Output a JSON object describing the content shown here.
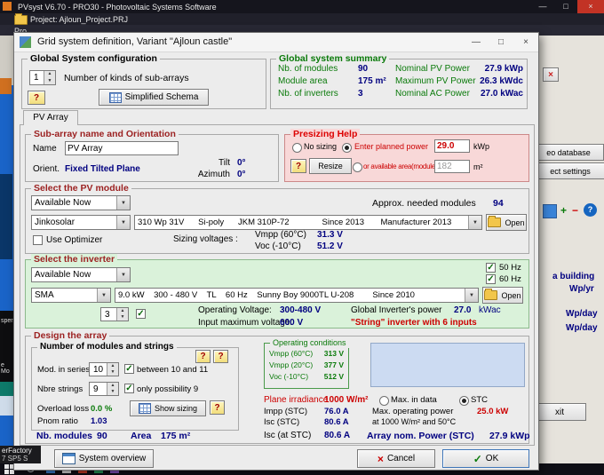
{
  "icons": {
    "minimize": "—",
    "maximize": "□",
    "close": "×",
    "combo_arrow": "▼",
    "spin_up": "▲",
    "spin_down": "▼",
    "check": "✓",
    "ok_check": "✓",
    "cancel_x": "×",
    "help": "?",
    "plus": "+",
    "minus": "−"
  },
  "titlebar": {
    "title": "PVsyst V6.70 - PRO30 - Photovoltaic Systems Software"
  },
  "project_bar": {
    "title": "Project: Ajloun_Project.PRJ",
    "menu_fragment": "Pro"
  },
  "dialog": {
    "title": "Grid system definition, Variant \"Ajloun castle\"",
    "config": {
      "title": "Global System configuration",
      "count": "1",
      "label": "Number of kinds of sub-arrays",
      "schema_btn": "Simplified Schema"
    },
    "summary": {
      "title": "Global system summary",
      "rows": [
        {
          "l1": "Nb. of modules",
          "v1": "90",
          "l2": "Nominal PV Power",
          "v2": "27.9 kWp"
        },
        {
          "l1": "Module area",
          "v1": "175 m²",
          "l2": "Maximum PV Power",
          "v2": "26.3 kWdc"
        },
        {
          "l1": "Nb. of inverters",
          "v1": "3",
          "l2": "Nominal AC Power",
          "v2": "27.0 kWac"
        }
      ]
    },
    "tab": "PV Array",
    "subarray": {
      "title": "Sub-array name and Orientation",
      "name_label": "Name",
      "name": "PV Array",
      "orient_label": "Orient.",
      "orient": "Fixed Tilted Plane",
      "tilt_label": "Tilt",
      "tilt": "0°",
      "azimuth_label": "Azimuth",
      "azimuth": "0°"
    },
    "presizing": {
      "title": "Presizing Help",
      "no_sizing": "No sizing",
      "planned_label": "Enter planned power",
      "planned": "29.0",
      "planned_unit": "kWp",
      "resize": "Resize",
      "area_label": "or available area(modules)",
      "area": "182",
      "area_unit": "m²"
    },
    "module": {
      "title": "Select the PV module",
      "filter": "Available Now",
      "approx_label": "Approx. needed modules",
      "approx": "94",
      "maker": "Jinkosolar",
      "model": "310 Wp 31V      Si-poly      JKM 310P-72              Since 2013       Manufacturer 2013",
      "open": "Open",
      "optimizer": "Use Optimizer",
      "sizing_label": "Sizing voltages :",
      "vmpp_label": "Vmpp (60°C)",
      "vmpp": "31.3 V",
      "voc_label": "Voc (-10°C)",
      "voc": "51.2 V"
    },
    "inverter": {
      "title": "Select the inverter",
      "filter": "Available Now",
      "f50": "50 Hz",
      "f60": "60 Hz",
      "maker": "SMA",
      "model": "9.0 kW    300 - 480 V    TL    60 Hz    Sunny Boy 9000TL U-208        Since 2010",
      "open": "Open",
      "nb_label": "Nb. of inverters",
      "nb": "3",
      "op_v_label": "Operating Voltage:",
      "op_v": "300-480 V",
      "gpow_label": "Global Inverter's power",
      "gpow": "27.0",
      "gpow_unit": "kWac",
      "max_v_label": "Input maximum voltage:",
      "max_v": "600 V",
      "note": "\"String\" inverter with 6 inputs"
    },
    "design": {
      "title": "Design the array",
      "mods": {
        "title": "Number of modules and strings",
        "series_label": "Mod. in series",
        "series": "10",
        "series_hint": "between 10 and 11",
        "strings_label": "Nbre strings",
        "strings": "9",
        "strings_hint": "only possibility 9",
        "overload_label": "Overload loss",
        "overload": "0.0 %",
        "pnom_label": "Pnom ratio",
        "pnom": "1.03",
        "show_sizing": "Show sizing"
      },
      "opcond": {
        "title": "Operating conditions",
        "rows": [
          {
            "l": "Vmpp (60°C)",
            "v": "313 V"
          },
          {
            "l": "Vmpp (20°C)",
            "v": "377 V"
          },
          {
            "l": "Voc (-10°C)",
            "v": "512 V"
          }
        ]
      },
      "irr_label": "Plane irradiance",
      "irr": "1000 W/m²",
      "max_in_data": "Max. in data",
      "stc": "STC",
      "impp_label": "Impp (STC)",
      "impp": "76.0 A",
      "isc_label": "Isc (STC)",
      "isc": "80.6 A",
      "mp_label": "Max. operating power",
      "mp": "25.0 kW",
      "mp_cond": "at 1000 W/m² and 50°C",
      "isc2_label": "Isc (at STC)",
      "isc2": "80.6 A",
      "ap_label": "Array nom. Power (STC)",
      "ap": "27.9 kWp",
      "nbm_label": "Nb. modules",
      "nbm": "90",
      "area_label": "Area",
      "area": "175 m²"
    },
    "footer": {
      "overview": "System overview",
      "cancel": "Cancel",
      "ok": "OK"
    }
  },
  "background": {
    "right": {
      "meteo": "eo database",
      "settings": "ect settings",
      "building": "a building",
      "wpyr": "Wp/yr",
      "wpday1": "Wp/day",
      "wpday2": "Wp/day",
      "exit": "xit"
    },
    "left": {
      "frag1": "spers",
      "frag2": "e Mo"
    },
    "bottom": {
      "line1": "erFactory",
      "line2": "7 SP5 S"
    }
  }
}
